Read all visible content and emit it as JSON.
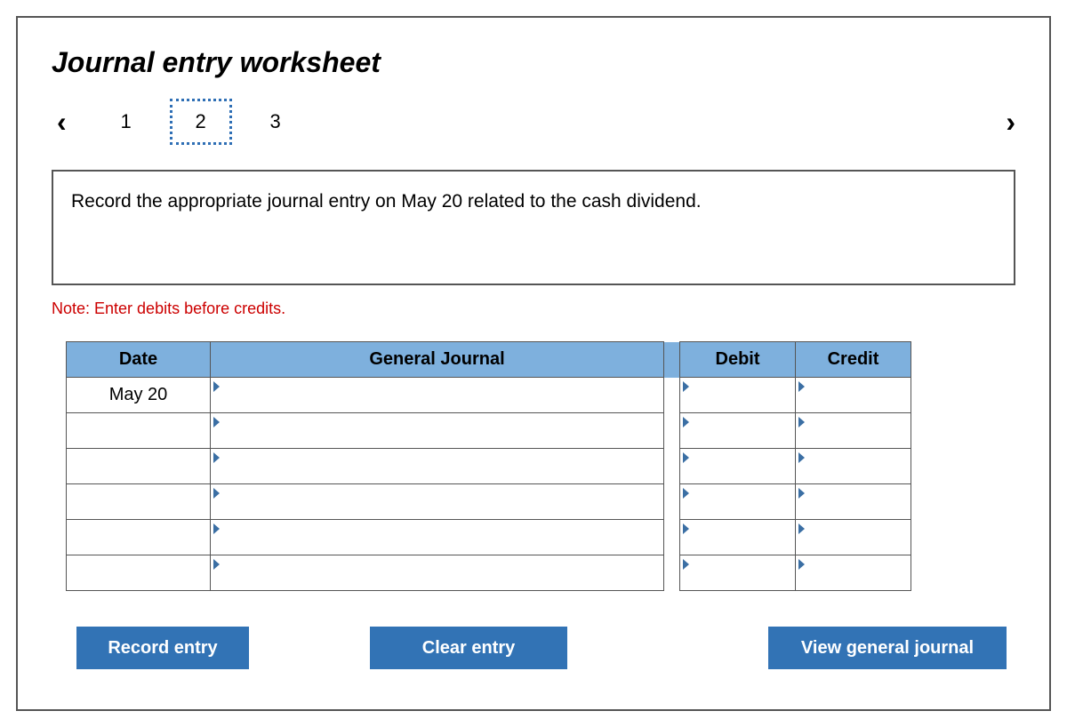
{
  "title": "Journal entry worksheet",
  "nav": {
    "prev": "‹",
    "next": "›"
  },
  "steps": [
    {
      "label": "1",
      "selected": false
    },
    {
      "label": "2",
      "selected": true
    },
    {
      "label": "3",
      "selected": false
    }
  ],
  "instruction": "Record the appropriate journal entry on May 20 related to the cash dividend.",
  "note": "Note: Enter debits before credits.",
  "table": {
    "headers": {
      "date": "Date",
      "journal": "General Journal",
      "debit": "Debit",
      "credit": "Credit"
    },
    "rows": [
      {
        "date": "May 20",
        "journal": "",
        "debit": "",
        "credit": ""
      },
      {
        "date": "",
        "journal": "",
        "debit": "",
        "credit": ""
      },
      {
        "date": "",
        "journal": "",
        "debit": "",
        "credit": ""
      },
      {
        "date": "",
        "journal": "",
        "debit": "",
        "credit": ""
      },
      {
        "date": "",
        "journal": "",
        "debit": "",
        "credit": ""
      },
      {
        "date": "",
        "journal": "",
        "debit": "",
        "credit": ""
      }
    ]
  },
  "buttons": {
    "record": "Record entry",
    "clear": "Clear entry",
    "view": "View general journal"
  }
}
